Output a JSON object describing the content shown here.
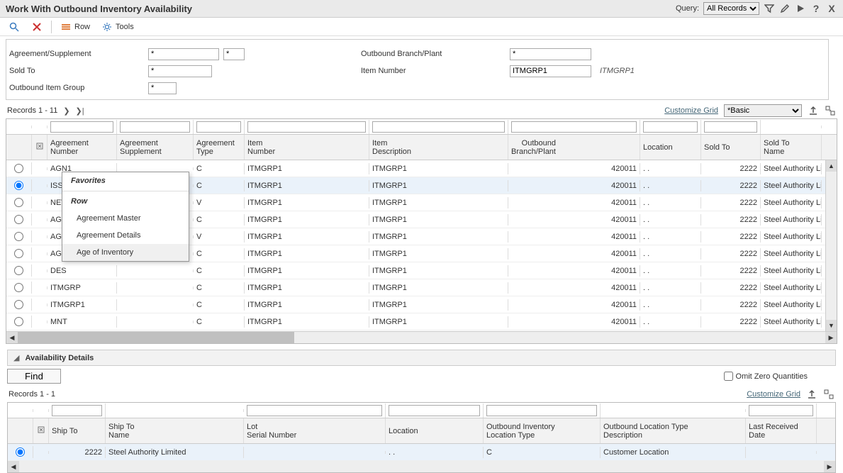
{
  "title": "Work With Outbound Inventory Availability",
  "query_label": "Query:",
  "query_select": "All Records",
  "toolbar": {
    "row": "Row",
    "tools": "Tools"
  },
  "filters": {
    "agreement_supp": {
      "label": "Agreement/Supplement",
      "v1": "*",
      "v2": "*"
    },
    "outbound_bp": {
      "label": "Outbound Branch/Plant",
      "v": "*"
    },
    "sold_to": {
      "label": "Sold To",
      "v": "*"
    },
    "item_number": {
      "label": "Item Number",
      "v": "ITMGRP1",
      "desc": "ITMGRP1"
    },
    "out_item_group": {
      "label": "Outbound Item Group",
      "v": "*"
    }
  },
  "grid1": {
    "records_label": "Records 1 - 11",
    "customize": "Customize Grid",
    "view_select": "*Basic",
    "headers": {
      "agr_num": "Agreement\nNumber",
      "agr_sup": "Agreement\nSupplement",
      "agr_typ": "Agreement\nType",
      "item_num": "Item\nNumber",
      "item_desc": "Item\nDescription",
      "out_bp": "Outbound\nBranch/Plant",
      "location": "Location",
      "sold_to": "Sold To",
      "sold_to_name": "Sold To\nName"
    },
    "rows": [
      {
        "agr": "AGN1",
        "typ": "C",
        "itm": "ITMGRP1",
        "dsc": "ITMGRP1",
        "bp": "420011",
        "loc": ".  .",
        "sold": "2222",
        "soldn": "Steel Authority Li"
      },
      {
        "agr": "ISS",
        "typ": "C",
        "itm": "ITMGRP1",
        "dsc": "ITMGRP1",
        "bp": "420011",
        "loc": ".  .",
        "sold": "2222",
        "soldn": "Steel Authority Li"
      },
      {
        "agr": "NEV",
        "typ": "V",
        "itm": "ITMGRP1",
        "dsc": "ITMGRP1",
        "bp": "420011",
        "loc": ".  .",
        "sold": "2222",
        "soldn": "Steel Authority Li"
      },
      {
        "agr": "AGM",
        "typ": "C",
        "itm": "ITMGRP1",
        "dsc": "ITMGRP1",
        "bp": "420011",
        "loc": ".  .",
        "sold": "2222",
        "soldn": "Steel Authority Li"
      },
      {
        "agr": "AGN",
        "typ": "V",
        "itm": "ITMGRP1",
        "dsc": "ITMGRP1",
        "bp": "420011",
        "loc": ".  .",
        "sold": "2222",
        "soldn": "Steel Authority Li"
      },
      {
        "agr": "AGR",
        "typ": "C",
        "itm": "ITMGRP1",
        "dsc": "ITMGRP1",
        "bp": "420011",
        "loc": ".  .",
        "sold": "2222",
        "soldn": "Steel Authority Li"
      },
      {
        "agr": "DES",
        "typ": "C",
        "itm": "ITMGRP1",
        "dsc": "ITMGRP1",
        "bp": "420011",
        "loc": ".  .",
        "sold": "2222",
        "soldn": "Steel Authority Li"
      },
      {
        "agr": "ITMGRP",
        "typ": "C",
        "itm": "ITMGRP1",
        "dsc": "ITMGRP1",
        "bp": "420011",
        "loc": ".  .",
        "sold": "2222",
        "soldn": "Steel Authority Li"
      },
      {
        "agr": "ITMGRP1",
        "typ": "C",
        "itm": "ITMGRP1",
        "dsc": "ITMGRP1",
        "bp": "420011",
        "loc": ".  .",
        "sold": "2222",
        "soldn": "Steel Authority Li"
      },
      {
        "agr": "MNT",
        "typ": "C",
        "itm": "ITMGRP1",
        "dsc": "ITMGRP1",
        "bp": "420011",
        "loc": ".  .",
        "sold": "2222",
        "soldn": "Steel Authority Li"
      }
    ]
  },
  "context_menu": {
    "favorites": "Favorites",
    "row": "Row",
    "items": [
      "Agreement Master",
      "Agreement Details",
      "Age of Inventory"
    ]
  },
  "details": {
    "title": "Availability Details",
    "find": "Find",
    "omit": "Omit Zero Quantities",
    "records_label": "Records 1 - 1",
    "customize": "Customize Grid",
    "headers": {
      "ship_to": "Ship To",
      "ship_to_name": "Ship To\nName",
      "lot": "Lot\nSerial Number",
      "location": "Location",
      "oil_type": "Outbound Inventory\nLocation Type",
      "ol_desc": "Outbound Location Type\nDescription",
      "last_rcv": "Last Received\nDate"
    },
    "rows": [
      {
        "ship": "2222",
        "shipn": "Steel Authority Limited",
        "lot": "",
        "loc": ".  .",
        "typ": "C",
        "desc": "Customer Location",
        "lrd": ""
      }
    ]
  }
}
